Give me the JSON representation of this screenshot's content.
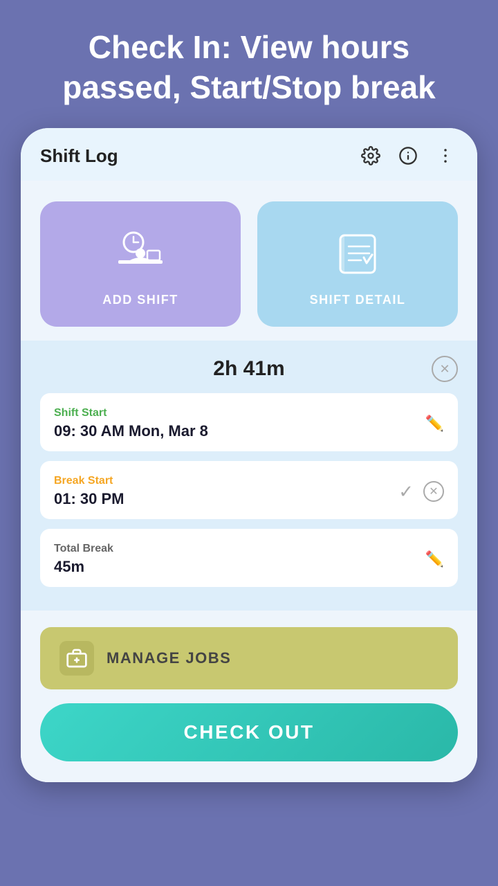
{
  "header": {
    "title": "Check In: View hours passed, Start/Stop break"
  },
  "appBar": {
    "title": "Shift Log"
  },
  "cards": [
    {
      "id": "add-shift",
      "label": "ADD SHIFT",
      "icon": "add-shift-icon"
    },
    {
      "id": "shift-detail",
      "label": "SHIFT DETAIL",
      "icon": "shift-detail-icon"
    }
  ],
  "shiftPanel": {
    "duration": "2h 41m",
    "rows": [
      {
        "id": "shift-start",
        "label": "Shift Start",
        "labelColor": "green",
        "value": "09: 30 AM Mon, Mar 8",
        "action": "edit"
      },
      {
        "id": "break-start",
        "label": "Break Start",
        "labelColor": "orange",
        "value": "01: 30 PM",
        "action": "check-x"
      },
      {
        "id": "total-break",
        "label": "Total Break",
        "labelColor": "gray",
        "value": "45m",
        "action": "edit"
      }
    ]
  },
  "manageJobs": {
    "label": "MANAGE JOBS"
  },
  "checkout": {
    "label": "CHECK OUT"
  }
}
